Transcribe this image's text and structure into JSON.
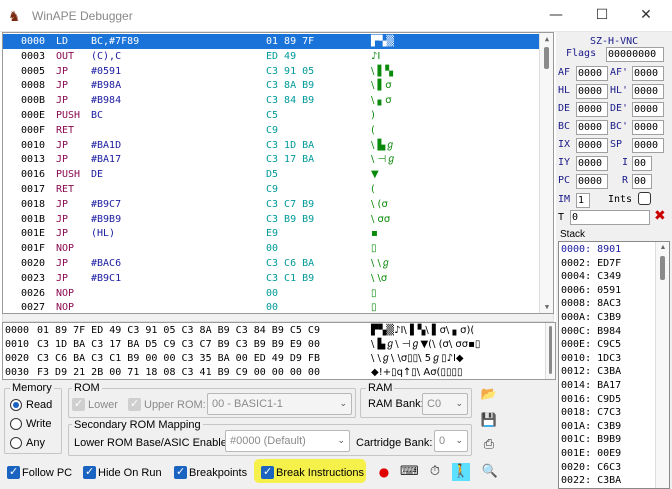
{
  "window": {
    "title": "WinAPE Debugger",
    "minimize": "—",
    "maximize": "☐",
    "close": "✕"
  },
  "disassembly": [
    {
      "addr": "0000",
      "mn": "LD",
      "op": "BC,#7F89",
      "hex": "01 89 7F",
      "chr": "▛▚▒",
      "sel": true
    },
    {
      "addr": "0003",
      "mn": "OUT",
      "op": "(C),C",
      "hex": "ED 49",
      "chr": "♪I"
    },
    {
      "addr": "0005",
      "mn": "JP",
      "op": "#0591",
      "hex": "C3 91 05",
      "chr": "\\ ▌▚"
    },
    {
      "addr": "0008",
      "mn": "JP",
      "op": "#B98A",
      "hex": "C3 8A B9",
      "chr": "\\ ▌σ"
    },
    {
      "addr": "000B",
      "mn": "JP",
      "op": "#B984",
      "hex": "C3 84 B9",
      "chr": "\\ ▖σ"
    },
    {
      "addr": "000E",
      "mn": "PUSH",
      "op": "BC",
      "hex": "C5",
      "chr": ")"
    },
    {
      "addr": "000F",
      "mn": "RET",
      "op": "",
      "hex": "C9",
      "chr": "("
    },
    {
      "addr": "0010",
      "mn": "JP",
      "op": "#BA1D",
      "hex": "C3 1D BA",
      "chr": "\\ ▙ℊ"
    },
    {
      "addr": "0013",
      "mn": "JP",
      "op": "#BA17",
      "hex": "C3 17 BA",
      "chr": "\\ ⊣ℊ"
    },
    {
      "addr": "0016",
      "mn": "PUSH",
      "op": "DE",
      "hex": "D5",
      "chr": "▼"
    },
    {
      "addr": "0017",
      "mn": "RET",
      "op": "",
      "hex": "C9",
      "chr": "("
    },
    {
      "addr": "0018",
      "mn": "JP",
      "op": "#B9C7",
      "hex": "C3 C7 B9",
      "chr": "\\ (σ"
    },
    {
      "addr": "001B",
      "mn": "JP",
      "op": "#B9B9",
      "hex": "C3 B9 B9",
      "chr": "\\ σσ"
    },
    {
      "addr": "001E",
      "mn": "JP",
      "op": "(HL)",
      "hex": "E9",
      "chr": "▪"
    },
    {
      "addr": "001F",
      "mn": "NOP",
      "op": "",
      "hex": "00",
      "chr": "▯"
    },
    {
      "addr": "0020",
      "mn": "JP",
      "op": "#BAC6",
      "hex": "C3 C6 BA",
      "chr": "\\ \\ℊ"
    },
    {
      "addr": "0023",
      "mn": "JP",
      "op": "#B9C1",
      "hex": "C3 C1 B9",
      "chr": "\\ \\σ"
    },
    {
      "addr": "0026",
      "mn": "NOP",
      "op": "",
      "hex": "00",
      "chr": "▯"
    },
    {
      "addr": "0027",
      "mn": "NOP",
      "op": "",
      "hex": "00",
      "chr": "▯"
    }
  ],
  "hexdump": [
    {
      "addr": "0000",
      "bytes": "01 89 7F ED 49 C3 91 05 C3 8A B9 C3 84 B9 C5 C9",
      "chr": "▛▚▒♪I\\ ▌▚\\ ▌σ\\ ▖σ)("
    },
    {
      "addr": "0010",
      "bytes": "C3 1D BA C3 17 BA D5 C9 C3 C7 B9 C3 B9 B9 E9 00",
      "chr": "\\ ▙ℊ\\ ⊣ℊ▼(\\ (σ\\ σσ▪▯"
    },
    {
      "addr": "0020",
      "bytes": "C3 C6 BA C3 C1 B9 00 00 C3 35 BA 00 ED 49 D9 FB",
      "chr": "\\ \\ℊ\\ \\σ▯▯\\ 5ℊ▯♪I◆"
    },
    {
      "addr": "0030",
      "bytes": "F3 D9 21 2B 00 71 18 08 C3 41 B9 C9 00 00 00 00",
      "chr": "◆!+▯q↑▯\\ Aσ(▯▯▯▯"
    }
  ],
  "memory": {
    "group": "Memory",
    "options": [
      "Read",
      "Write",
      "Any"
    ],
    "selected": "Read"
  },
  "rom": {
    "group": "ROM",
    "lower": "Lower",
    "upper": "Upper ROM:",
    "upper_value": "00 - BASIC1-1"
  },
  "ram": {
    "group": "RAM",
    "bank_label": "RAM Bank:",
    "bank_value": "C0"
  },
  "secondary": {
    "group": "Secondary ROM Mapping",
    "base_label": "Lower ROM Base/ASIC Enable:",
    "base_value": "#0000 (Default)",
    "cart_label": "Cartridge Bank:",
    "cart_value": "0"
  },
  "checks": {
    "follow_pc": "Follow PC",
    "hide_on_run": "Hide On Run",
    "breakpoints": "Breakpoints",
    "break_instructions": "Break Instructions"
  },
  "colors": {
    "highlight": "#f6f04a",
    "accent": "#1a63c0",
    "selection": "#1a73d9"
  },
  "registers": {
    "flags_title": "SZ-H-VNC",
    "flags_label": "Flags",
    "flags_value": "00000000",
    "AF": "0000",
    "AF_": "0000",
    "HL": "0000",
    "HL_": "0000",
    "DE": "0000",
    "DE_": "0000",
    "BC": "0000",
    "BC_": "0000",
    "IX": "0000",
    "SP": "0000",
    "IY": "0000",
    "I": "00",
    "PC": "0000",
    "R": "00",
    "IM": "1",
    "ints_label": "Ints",
    "T": "0"
  },
  "reg_labels": {
    "AF": "AF",
    "AF_": "AF'",
    "HL": "HL",
    "HL_": "HL'",
    "DE": "DE",
    "DE_": "DE'",
    "BC": "BC",
    "BC_": "BC'",
    "IX": "IX",
    "SP": "SP",
    "IY": "IY",
    "I": "I",
    "PC": "PC",
    "R": "R",
    "IM": "IM",
    "T": "T"
  },
  "stack": {
    "label": "Stack",
    "rows": [
      "0000: 8901",
      "0002: ED7F",
      "0004: C349",
      "0006: 0591",
      "0008: 8AC3",
      "000A: C3B9",
      "000C: B984",
      "000E: C9C5",
      "0010: 1DC3",
      "0012: C3BA",
      "0014: BA17",
      "0016: C9D5",
      "0018: C7C3",
      "001A: C3B9",
      "001C: B9B9",
      "001E: 00E9",
      "0020: C6C3",
      "0022: C3BA"
    ]
  }
}
